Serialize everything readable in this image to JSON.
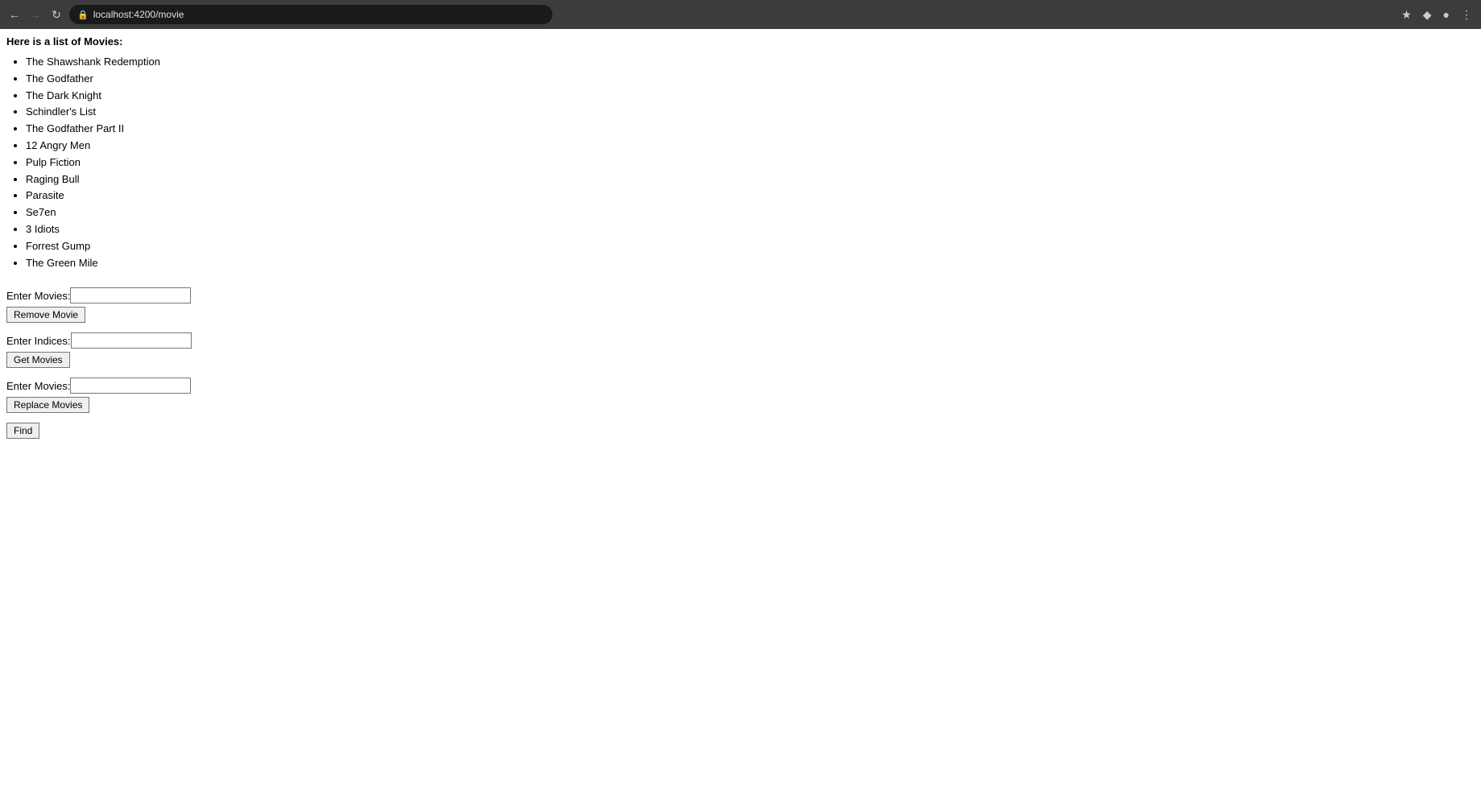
{
  "browser": {
    "url": "localhost:4200/movie",
    "back_disabled": false,
    "forward_disabled": true
  },
  "page": {
    "title": "Here is a list of Movies:",
    "movies": [
      "The Shawshank Redemption",
      "The Godfather",
      "The Dark Knight",
      "Schindler's List",
      "The Godfather Part II",
      "12 Angry Men",
      "Pulp Fiction",
      "Raging Bull",
      "Parasite",
      "Se7en",
      "3 Idiots",
      "Forrest Gump",
      "The Green Mile"
    ],
    "remove_section": {
      "label": "Enter Movies:",
      "input_value": "",
      "button_label": "Remove Movie"
    },
    "indices_section": {
      "label": "Enter Indices:",
      "input_value": "",
      "button_label": "Get Movies"
    },
    "replace_section": {
      "label": "Enter Movies:",
      "input_value": "",
      "button_label": "Replace Movies"
    },
    "find_button_label": "Find"
  }
}
